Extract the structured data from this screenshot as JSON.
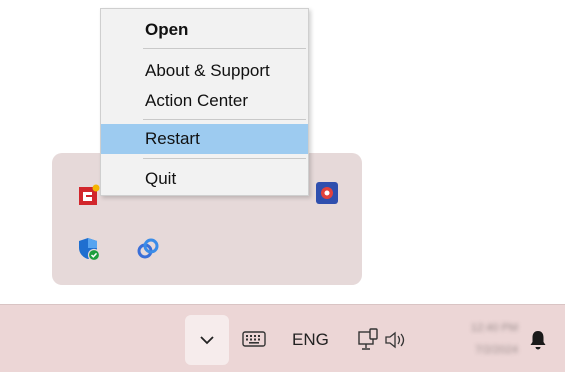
{
  "context_menu": {
    "items": [
      {
        "label": "Open"
      },
      {
        "label": "About & Support"
      },
      {
        "label": "Action Center"
      },
      {
        "label": "Restart"
      },
      {
        "label": "Quit"
      }
    ],
    "highlighted_item": "Restart"
  },
  "tray_flyout": {
    "icons": [
      "app-logo-icon",
      "blue-circle-icon",
      "green-monitor-icon",
      "pencil-icon",
      "gear-app-icon",
      "windows-security-icon",
      "link-sync-icon"
    ]
  },
  "taskbar": {
    "language": "ENG",
    "clock_time": "12:40 PM",
    "clock_date": "7/2/2024"
  },
  "colors": {
    "highlight": "#9dcbf0",
    "taskbar_bg": "#ecd6d6",
    "flyout_bg": "#e6d9d9"
  }
}
